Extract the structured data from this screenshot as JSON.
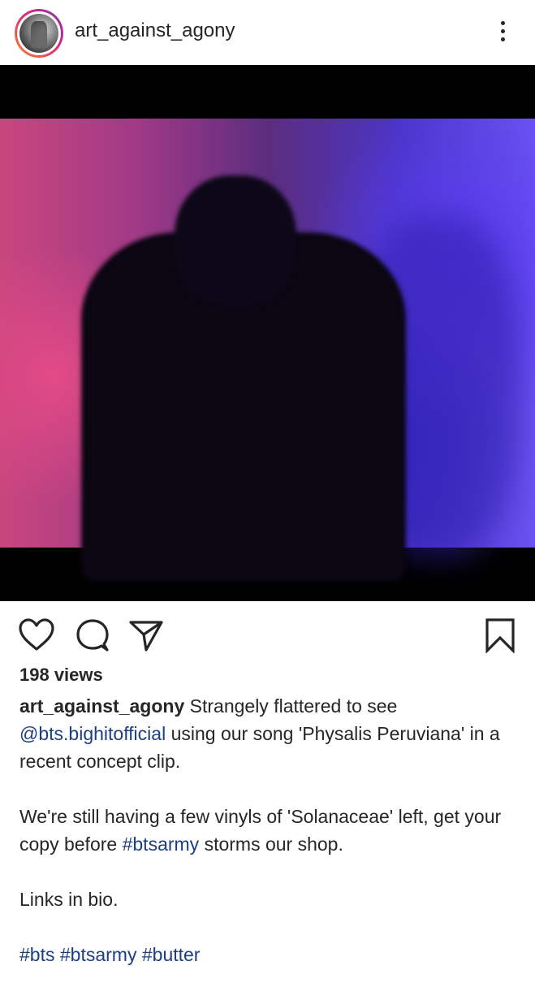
{
  "post": {
    "username": "art_against_agony",
    "views": "198 views"
  },
  "caption": {
    "username": "art_against_agony",
    "line1_text": " Strangely flattered to see ",
    "mention": "@bts.bighitofficial",
    "line1_rest": " using our song 'Physalis Peruviana' in a recent concept clip.",
    "para2_before": "We're still having a few vinyls of 'Solanaceae' left, get your copy before ",
    "para2_hashtag": "#btsarmy",
    "para2_after": " storms our shop.",
    "para3": "Links in bio.",
    "hashtags": [
      "#bts",
      "#btsarmy",
      "#butter"
    ]
  },
  "icons": {
    "like": "heart-icon",
    "comment": "comment-icon",
    "share": "send-icon",
    "save": "bookmark-icon",
    "more": "more-vertical-icon"
  },
  "colors": {
    "text": "#262626",
    "link": "#1c3f82"
  }
}
